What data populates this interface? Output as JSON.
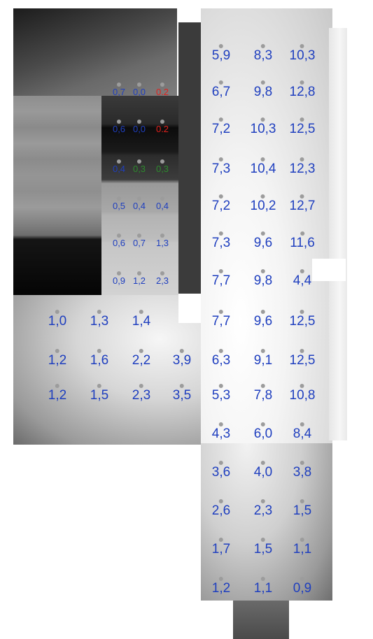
{
  "colors": {
    "blue": "#1f3fbf",
    "red": "#e0201c",
    "green": "#2e8b2e",
    "dot": "#9c9c9c"
  },
  "sensors": [
    {
      "label": "5,9",
      "col": "c1",
      "row": "r1"
    },
    {
      "label": "8,3",
      "col": "c2",
      "row": "r1"
    },
    {
      "label": "10,3",
      "col": "c3",
      "row": "r1"
    },
    {
      "label": "0,7",
      "col": "s1",
      "row": "r2",
      "small": true
    },
    {
      "label": "0,0",
      "col": "s2",
      "row": "r2",
      "small": true
    },
    {
      "label": "0.2",
      "col": "s3",
      "row": "r2",
      "small": true,
      "color": "red"
    },
    {
      "label": "6,7",
      "col": "c1",
      "row": "r2"
    },
    {
      "label": "9,8",
      "col": "c2",
      "row": "r2"
    },
    {
      "label": "12,8",
      "col": "c3",
      "row": "r2"
    },
    {
      "label": "0,6",
      "col": "s1",
      "row": "r3",
      "small": true
    },
    {
      "label": "0,0",
      "col": "s2",
      "row": "r3",
      "small": true
    },
    {
      "label": "0.2",
      "col": "s3",
      "row": "r3",
      "small": true,
      "color": "red"
    },
    {
      "label": "7,2",
      "col": "c1",
      "row": "r3"
    },
    {
      "label": "10,3",
      "col": "c2",
      "row": "r3"
    },
    {
      "label": "12,5",
      "col": "c3",
      "row": "r3"
    },
    {
      "label": "0,4",
      "col": "s1",
      "row": "r4",
      "small": true
    },
    {
      "label": "0,3",
      "col": "s2",
      "row": "r4",
      "small": true,
      "color": "green"
    },
    {
      "label": "0,3",
      "col": "s3",
      "row": "r4",
      "small": true,
      "color": "green"
    },
    {
      "label": "7,3",
      "col": "c1",
      "row": "r4"
    },
    {
      "label": "10,4",
      "col": "c2",
      "row": "r4"
    },
    {
      "label": "12,3",
      "col": "c3",
      "row": "r4"
    },
    {
      "label": "0,5",
      "col": "s1",
      "row": "r5",
      "small": true
    },
    {
      "label": "0,4",
      "col": "s2",
      "row": "r5",
      "small": true
    },
    {
      "label": "0,4",
      "col": "s3",
      "row": "r5",
      "small": true
    },
    {
      "label": "7,2",
      "col": "c1",
      "row": "r5"
    },
    {
      "label": "10,2",
      "col": "c2",
      "row": "r5"
    },
    {
      "label": "12,7",
      "col": "c3",
      "row": "r5"
    },
    {
      "label": "0,6",
      "col": "s1",
      "row": "r6",
      "small": true
    },
    {
      "label": "0,7",
      "col": "s2",
      "row": "r6",
      "small": true
    },
    {
      "label": "1,3",
      "col": "s3",
      "row": "r6",
      "small": true
    },
    {
      "label": "7,3",
      "col": "c1",
      "row": "r6"
    },
    {
      "label": "9,6",
      "col": "c2",
      "row": "r6"
    },
    {
      "label": "11,6",
      "col": "c3",
      "row": "r6"
    },
    {
      "label": "0,9",
      "col": "s1",
      "row": "r7",
      "small": true
    },
    {
      "label": "1,2",
      "col": "s2",
      "row": "r7",
      "small": true
    },
    {
      "label": "2,3",
      "col": "s3",
      "row": "r7",
      "small": true
    },
    {
      "label": "7,7",
      "col": "c1",
      "row": "r7"
    },
    {
      "label": "9,8",
      "col": "c2",
      "row": "r7"
    },
    {
      "label": "4,4",
      "col": "c3",
      "row": "r7"
    },
    {
      "label": "1,0",
      "col": "l1",
      "row": "r8"
    },
    {
      "label": "1,3",
      "col": "l2",
      "row": "r8"
    },
    {
      "label": "1,4",
      "col": "l3",
      "row": "r8"
    },
    {
      "label": "7,7",
      "col": "c1",
      "row": "r8"
    },
    {
      "label": "9,6",
      "col": "c2",
      "row": "r8"
    },
    {
      "label": "12,5",
      "col": "c3",
      "row": "r8"
    },
    {
      "label": "1,2",
      "col": "l1",
      "row": "r9"
    },
    {
      "label": "1,6",
      "col": "l2",
      "row": "r9"
    },
    {
      "label": "2,2",
      "col": "l3",
      "row": "r9"
    },
    {
      "label": "3,9",
      "col": "l4",
      "row": "r9"
    },
    {
      "label": "6,3",
      "col": "c1",
      "row": "r9"
    },
    {
      "label": "9,1",
      "col": "c2",
      "row": "r9"
    },
    {
      "label": "12,5",
      "col": "c3",
      "row": "r9"
    },
    {
      "label": "1,2",
      "col": "l1",
      "row": "r10"
    },
    {
      "label": "1,5",
      "col": "l2",
      "row": "r10"
    },
    {
      "label": "2,3",
      "col": "l3",
      "row": "r10"
    },
    {
      "label": "3,5",
      "col": "l4",
      "row": "r10"
    },
    {
      "label": "5,3",
      "col": "c1",
      "row": "r10"
    },
    {
      "label": "7,8",
      "col": "c2",
      "row": "r10"
    },
    {
      "label": "10,8",
      "col": "c3",
      "row": "r10"
    },
    {
      "label": "4,3",
      "col": "c1",
      "row": "r11"
    },
    {
      "label": "6,0",
      "col": "c2",
      "row": "r11"
    },
    {
      "label": "8,4",
      "col": "c3",
      "row": "r11"
    },
    {
      "label": "3,6",
      "col": "c1",
      "row": "r12"
    },
    {
      "label": "4,0",
      "col": "c2",
      "row": "r12"
    },
    {
      "label": "3,8",
      "col": "c3",
      "row": "r12"
    },
    {
      "label": "2,6",
      "col": "c1",
      "row": "r13"
    },
    {
      "label": "2,3",
      "col": "c2",
      "row": "r13"
    },
    {
      "label": "1,5",
      "col": "c3",
      "row": "r13"
    },
    {
      "label": "1,7",
      "col": "c1",
      "row": "r14"
    },
    {
      "label": "1,5",
      "col": "c2",
      "row": "r14"
    },
    {
      "label": "1,1",
      "col": "c3",
      "row": "r14"
    },
    {
      "label": "1,2",
      "col": "c1",
      "row": "r15"
    },
    {
      "label": "1,1",
      "col": "c2",
      "row": "r15"
    },
    {
      "label": "0,9",
      "col": "c3",
      "row": "r15"
    }
  ]
}
